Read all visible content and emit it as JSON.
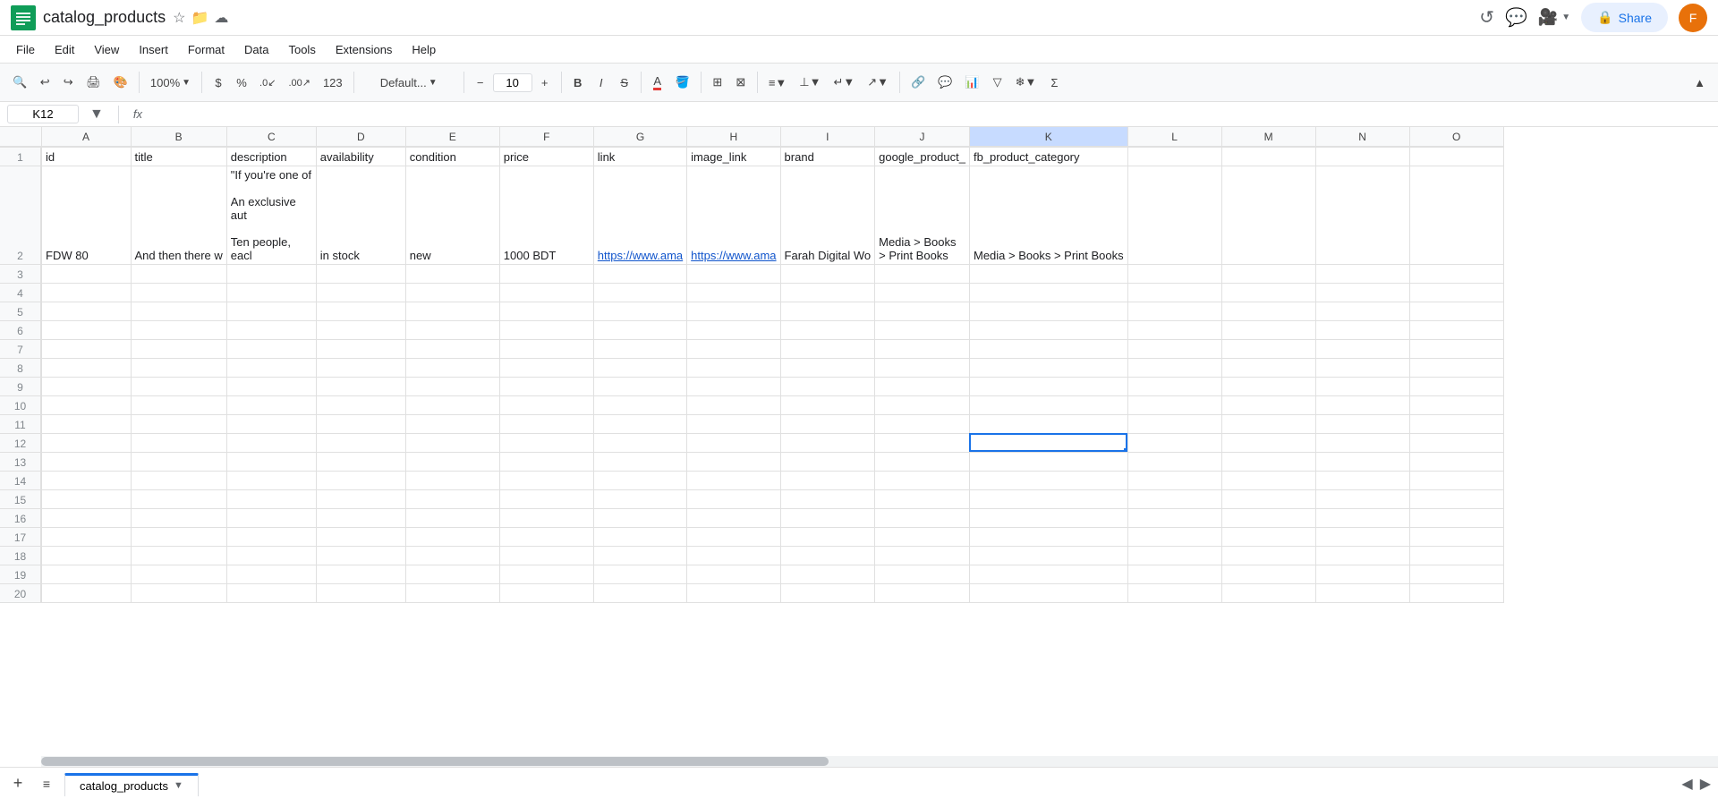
{
  "app": {
    "icon_color": "#0f9d58",
    "doc_title": "catalog_products",
    "share_label": "Share"
  },
  "menu": {
    "items": [
      "File",
      "Edit",
      "View",
      "Insert",
      "Format",
      "Data",
      "Tools",
      "Extensions",
      "Help"
    ]
  },
  "toolbar": {
    "zoom": "100%",
    "currency": "$",
    "percent": "%",
    "decrease_decimal": ".0",
    "increase_decimal": ".00",
    "format_123": "123",
    "font_name": "Default...",
    "font_size": "10",
    "bold": "B",
    "italic": "I",
    "strikethrough": "S"
  },
  "formula_bar": {
    "cell_ref": "K12",
    "fx": "fx"
  },
  "columns": {
    "headers": [
      "A",
      "B",
      "C",
      "D",
      "E",
      "F",
      "G",
      "H",
      "I",
      "J",
      "K",
      "L",
      "M",
      "N",
      "O"
    ]
  },
  "rows": {
    "headers": [
      1,
      2,
      3,
      4,
      5,
      6,
      7,
      8,
      9,
      10,
      11,
      12,
      13,
      14,
      15,
      16,
      17,
      18,
      19,
      20
    ]
  },
  "cells": {
    "row1": {
      "A": "id",
      "B": "title",
      "C": "description",
      "D": "availability",
      "E": "condition",
      "F": "price",
      "G": "link",
      "H": "image_link",
      "I": "brand",
      "J": "google_product_",
      "K": "fb_product_category",
      "L": "",
      "M": "",
      "N": "",
      "O": ""
    },
    "row2_A": "FDW 80",
    "row2_B": "And then there w",
    "row2_C_line1": "\"If you're one of",
    "row2_C_line2": "",
    "row2_C_line3": "An exclusive aut",
    "row2_C_line4": "",
    "row2_C_line5": "Ten people, eacl",
    "row2_C_full": "\"If you're one of\n\nAn exclusive aut\n\nTen people, eacl",
    "row2_D": "in stock",
    "row2_E": "new",
    "row2_F": "1000 BDT",
    "row2_G": "https://www.ama",
    "row2_H": "https://www.ama",
    "row2_I": "Farah Digital Wo",
    "row2_J_line1": "Media > Books",
    "row2_J_line2": "> Print Books",
    "row2_K": "Media > Books > Print Books"
  },
  "active_cell": "K12",
  "sheet_tab": {
    "name": "catalog_products"
  }
}
